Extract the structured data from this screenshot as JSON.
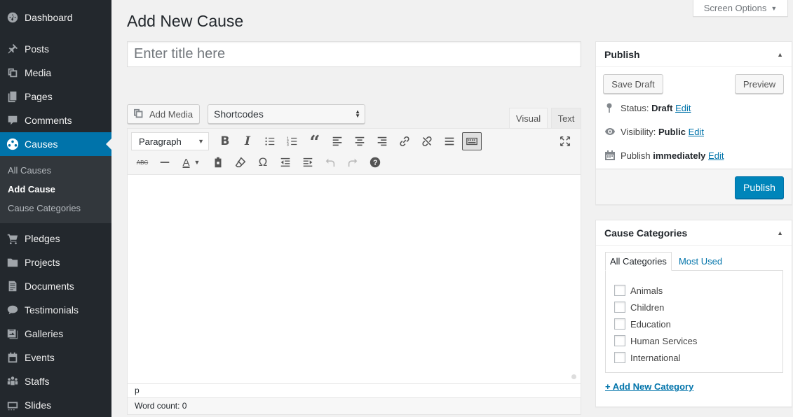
{
  "sidebar": {
    "items": [
      {
        "label": "Dashboard",
        "icon": "dashboard-icon"
      },
      {
        "label": "Posts",
        "icon": "pin-icon"
      },
      {
        "label": "Media",
        "icon": "media-icon"
      },
      {
        "label": "Pages",
        "icon": "pages-icon"
      },
      {
        "label": "Comments",
        "icon": "comment-icon"
      },
      {
        "label": "Causes",
        "icon": "causes-icon"
      },
      {
        "label": "Pledges",
        "icon": "cart-icon"
      },
      {
        "label": "Projects",
        "icon": "folder-icon"
      },
      {
        "label": "Documents",
        "icon": "document-icon"
      },
      {
        "label": "Testimonials",
        "icon": "chat-icon"
      },
      {
        "label": "Galleries",
        "icon": "gallery-icon"
      },
      {
        "label": "Events",
        "icon": "calendar-icon"
      },
      {
        "label": "Staffs",
        "icon": "people-icon"
      },
      {
        "label": "Slides",
        "icon": "slides-icon"
      }
    ],
    "submenu": [
      "All Causes",
      "Add Cause",
      "Cause Categories"
    ],
    "active_color": "#0073aa"
  },
  "header": {
    "screen_options": "Screen Options",
    "page_title": "Add New Cause"
  },
  "title_input": {
    "placeholder": "Enter title here"
  },
  "media": {
    "add_media": "Add Media",
    "shortcodes": "Shortcodes"
  },
  "editor": {
    "tab_visual": "Visual",
    "tab_text": "Text",
    "format": "Paragraph",
    "path": "p",
    "word_count": "Word count: 0"
  },
  "publish": {
    "title": "Publish",
    "save_draft": "Save Draft",
    "preview": "Preview",
    "status_label": "Status:",
    "status_value": "Draft",
    "visibility_label": "Visibility:",
    "visibility_value": "Public",
    "publish_label": "Publish",
    "publish_value": "immediately",
    "edit": "Edit",
    "publish_button": "Publish",
    "button_color": "#0085ba"
  },
  "categories": {
    "title": "Cause Categories",
    "tab_all": "All Categories",
    "tab_most_used": "Most Used",
    "items": [
      "Animals",
      "Children",
      "Education",
      "Human Services",
      "International"
    ],
    "add_new": "+ Add New Category"
  }
}
